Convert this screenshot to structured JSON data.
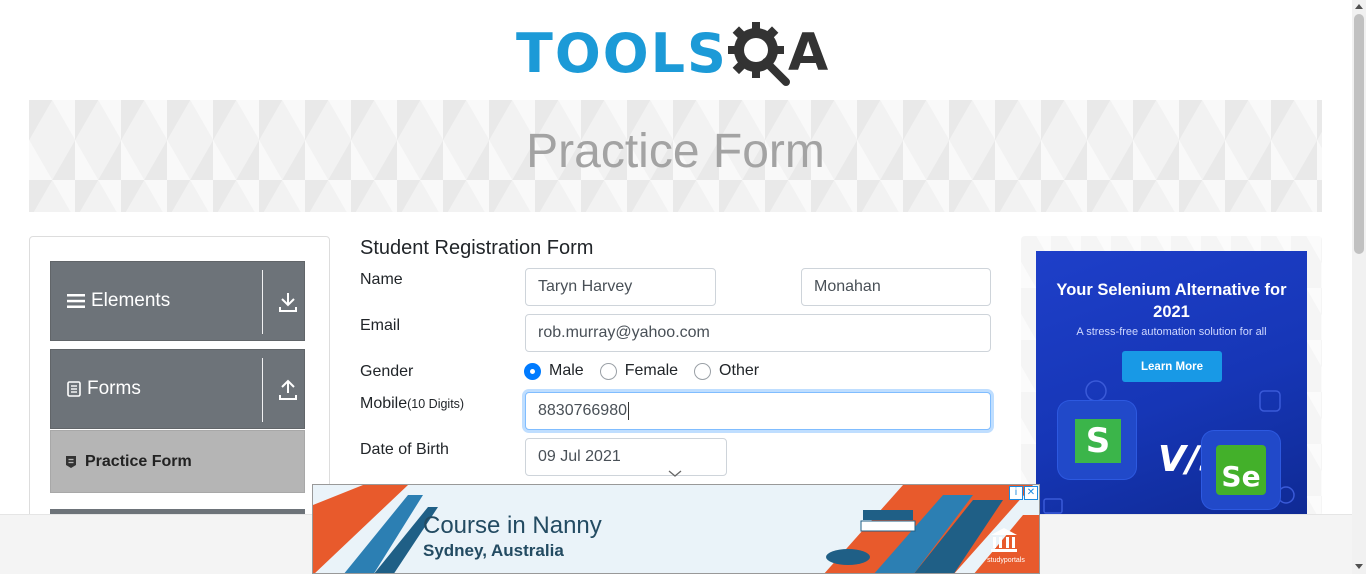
{
  "header": {
    "logo_text": "TOOLS",
    "logo_q": "Q",
    "logo_a": "A"
  },
  "banner": {
    "title": "Practice Form"
  },
  "sidebar": {
    "groups": [
      {
        "label": "Elements",
        "icon": "list-icon",
        "arrow": "download-arrow-icon"
      },
      {
        "label": "Forms",
        "icon": "document-icon",
        "arrow": "upload-arrow-icon"
      }
    ],
    "active_item": {
      "label": "Practice Form",
      "icon": "badge-icon"
    }
  },
  "form": {
    "title": "Student Registration Form",
    "name_label": "Name",
    "first_name": "Taryn Harvey",
    "last_name": "Monahan",
    "email_label": "Email",
    "email": "rob.murray@yahoo.com",
    "gender_label": "Gender",
    "gender_options": [
      "Male",
      "Female",
      "Other"
    ],
    "gender_selected": "Male",
    "mobile_label": "Mobile",
    "mobile_hint": "(10 Digits)",
    "mobile": "8830766980",
    "dob_label": "Date of Birth",
    "dob": "09 Jul 2021"
  },
  "right_ad": {
    "headline": "Your Selenium Alternative for 2021",
    "subline": "A stress-free automation solution for all",
    "button": "Learn More",
    "vs": "V/s",
    "tile_left": "S",
    "tile_right": "Se"
  },
  "bottom_ad": {
    "course": "Course in Nanny",
    "city": "Sydney, Australia",
    "brand": "studyportals"
  },
  "colors": {
    "brand_blue": "#1c9ad7",
    "sidebar_gray": "#6d7379",
    "radio_blue": "#007bff"
  }
}
